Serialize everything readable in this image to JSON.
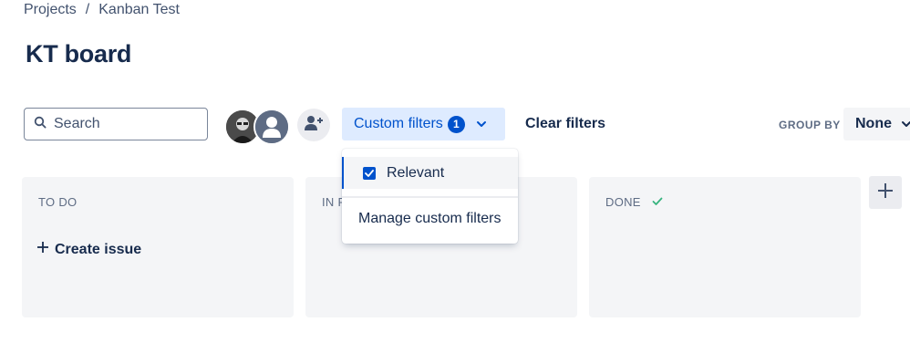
{
  "breadcrumb": {
    "items": [
      "Projects",
      "/",
      "Kanban Test"
    ]
  },
  "page": {
    "title": "KT board"
  },
  "toolbar": {
    "search_placeholder": "Search",
    "custom_filters_label": "Custom filters",
    "custom_filters_count": "1",
    "clear_filters_label": "Clear filters",
    "group_by_label": "GROUP BY",
    "group_by_value": "None"
  },
  "dropdown": {
    "items": [
      {
        "label": "Relevant",
        "checked": true
      },
      {
        "label": "Manage custom filters"
      }
    ]
  },
  "columns": [
    {
      "title": "TO DO",
      "action": "Create issue"
    },
    {
      "title": "IN P"
    },
    {
      "title": "DONE",
      "icon": "check-icon"
    }
  ],
  "colors": {
    "accent": "#0052cc",
    "accent_bg": "#deebff",
    "column_bg": "#f4f5f7",
    "text": "#172b4d",
    "done_check": "#36b37e"
  }
}
